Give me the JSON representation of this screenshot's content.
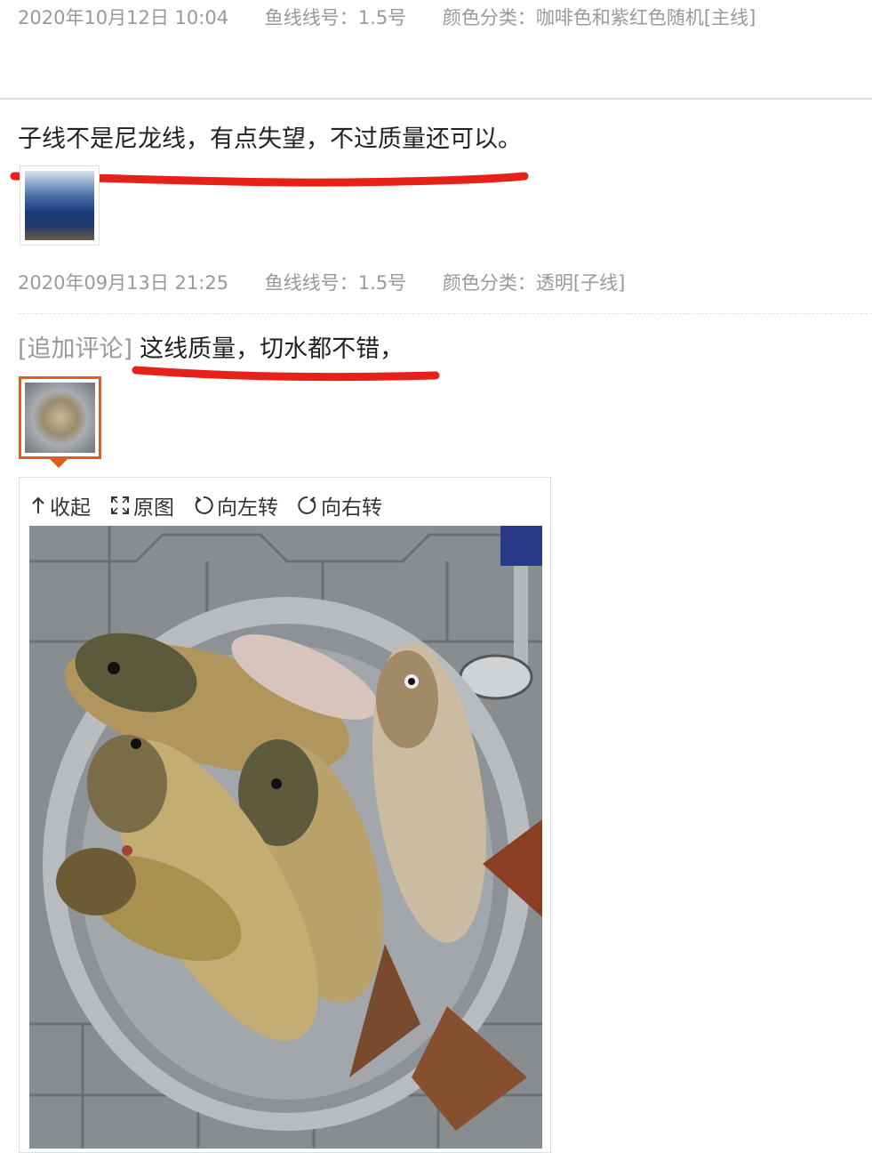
{
  "review1": {
    "date": "2020年10月12日 10:04",
    "spec_line": "鱼线线号：1.5号",
    "spec_color": "颜色分类：咖啡色和紫红色随机[主线]"
  },
  "review2": {
    "text": "子线不是尼龙线，有点失望，不过质量还可以。",
    "date": "2020年09月13日 21:25",
    "spec_line": "鱼线线号：1.5号",
    "spec_color": "颜色分类：透明[子线]"
  },
  "append": {
    "tag": "[追加评论]",
    "text": "这线质量，切水都不错，"
  },
  "toolbar": {
    "collapse": "收起",
    "original": "原图",
    "rotate_left": "向左转",
    "rotate_right": "向右转"
  },
  "colors": {
    "annotation_red": "#e8201a",
    "selected_border": "#e25d1c",
    "meta_gray": "#999999"
  },
  "icons": [
    "collapse-arrow-icon",
    "expand-icon",
    "rotate-left-icon",
    "rotate-right-icon"
  ]
}
